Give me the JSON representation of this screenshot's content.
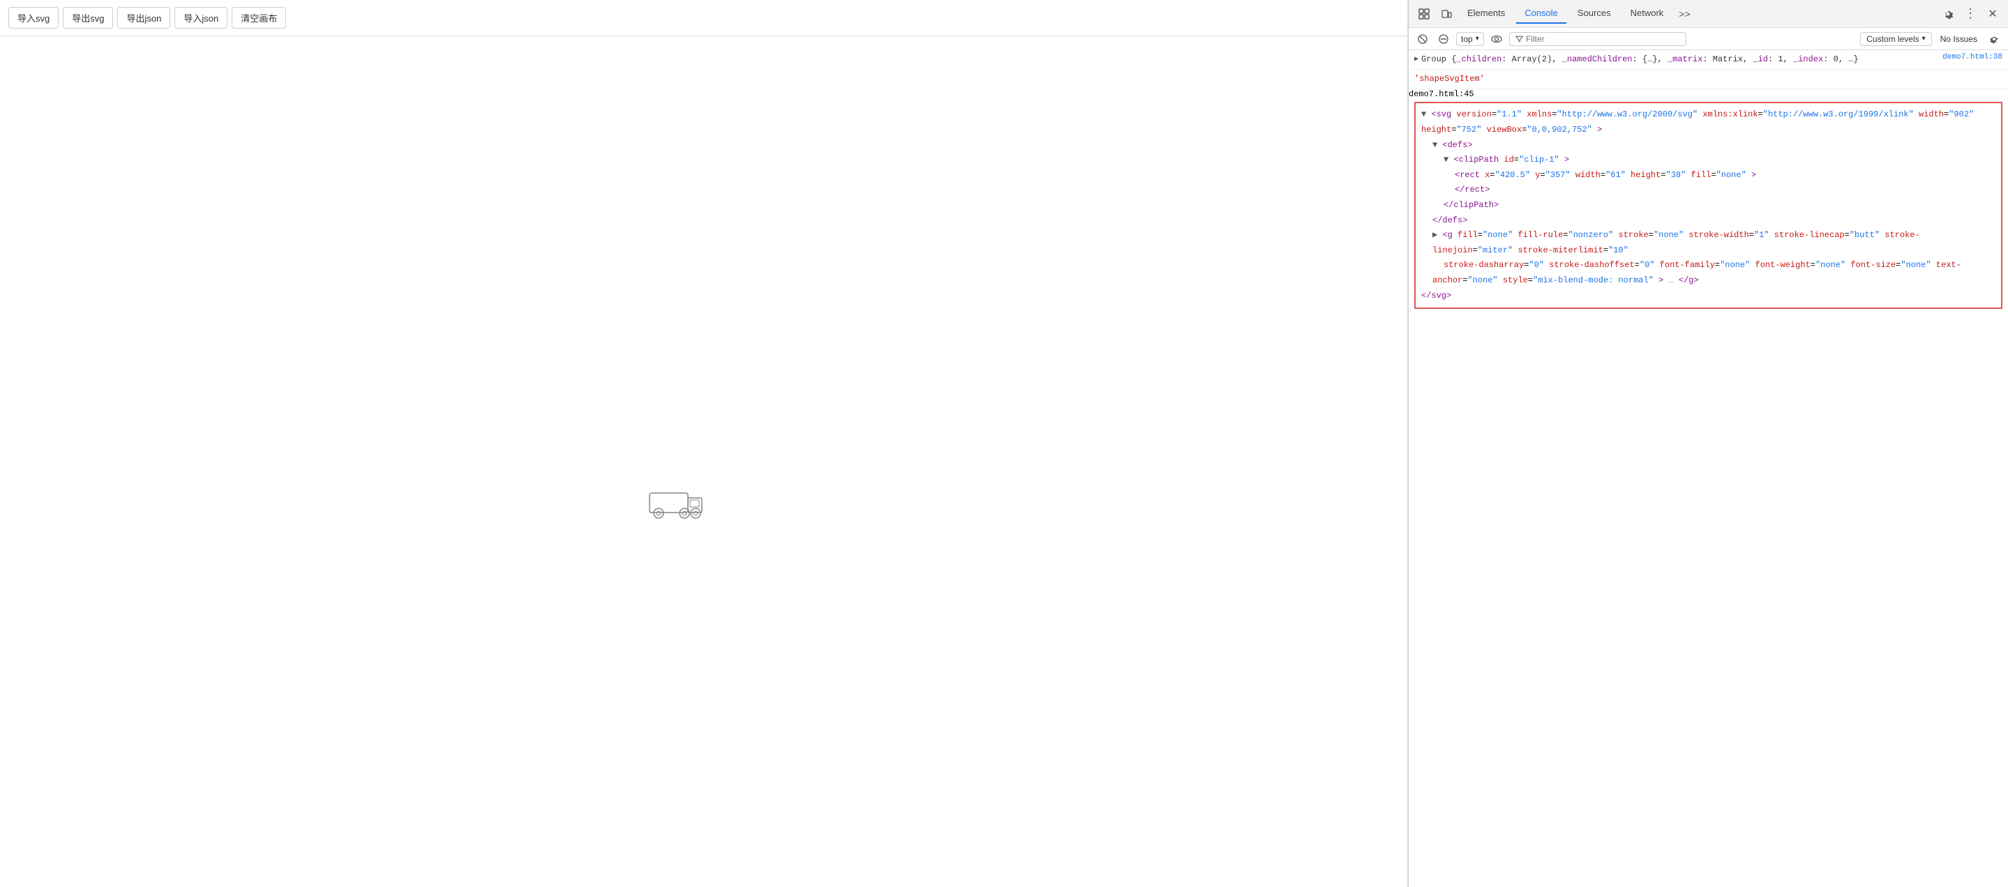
{
  "toolbar": {
    "btn1": "导入svg",
    "btn2": "导出svg",
    "btn3": "导出json",
    "btn4": "导入json",
    "btn5": "清空画布"
  },
  "devtools": {
    "tabs": [
      "Elements",
      "Console",
      "Sources",
      "Network"
    ],
    "active_tab": "Console",
    "more_label": ">>",
    "top_select": "top",
    "filter_placeholder": "Filter",
    "custom_levels": "Custom levels",
    "no_issues": "No Issues"
  },
  "console": {
    "entry1": {
      "file": "demo7.html:38",
      "text": "Group {_children: Array(2), _namedChildren: {…}, _matrix: Matrix, _id: 1, _index: 0, …}"
    },
    "entry2": {
      "string_value": "'shapeSvgItem'"
    },
    "entry3_file": "demo7.html:45",
    "svg_block": {
      "line1": "<svg version=\"1.1\" xmlns=\"http://www.w3.org/2000/svg\" xmlns:xlink=\"http://www.w3.org/1999/xlink\" width=\"902\" height=\"752\" viewBox=\"0,0,902,752\">",
      "line2": "▼ <defs>",
      "line3": "▼ <clipPath id=\"clip-1\">",
      "line4": "<rect x=\"420.5\" y=\"357\" width=\"61\" height=\"38\" fill=\"none\">",
      "line5": "</rect>",
      "line6": "</clipPath>",
      "line7": "</defs>",
      "line8_start": "▶ <g fill=\"none\" fill-rule=\"nonzero\" stroke=\"none\" stroke-width=\"1\" stroke-linecap=\"butt\" stroke-linejoin=\"miter\" stroke-miterlimit=\"10\" stroke-dasharray=\"0\" stroke-dashoffset=\"0\" font-family=\"none\" font-weight=\"none\" font-size=\"none\" text-anchor=\"none\" style=\"mix-blend-mode: normal\"> … </g>",
      "line9": "</svg>"
    }
  }
}
